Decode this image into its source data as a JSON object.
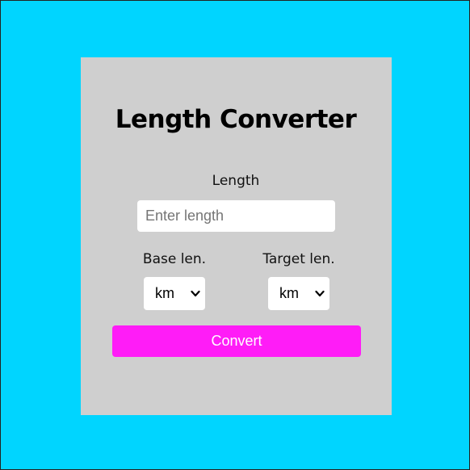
{
  "converter": {
    "title": "Length Converter",
    "length_label": "Length",
    "length_placeholder": "Enter length",
    "length_value": "",
    "base_label": "Base len.",
    "target_label": "Target len.",
    "base_unit": "km",
    "target_unit": "km",
    "convert_label": "Convert"
  },
  "colors": {
    "background": "#00d5ff",
    "card": "#cfcfcf",
    "button": "#ff1cf7",
    "button_text": "#ffffff"
  },
  "icons": {
    "select_chevron": "chevron-down-icon"
  }
}
